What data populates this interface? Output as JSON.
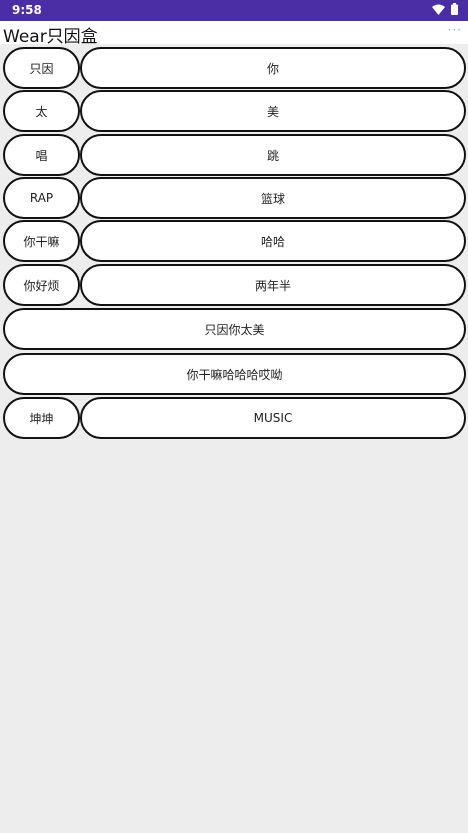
{
  "status": {
    "time": "9:58",
    "wifi_icon": "wifi-icon",
    "battery_icon": "battery-icon"
  },
  "appbar": {
    "title": "Wear只因盒",
    "menu": "···"
  },
  "rows": [
    {
      "left": "只因",
      "right": "你"
    },
    {
      "left": "太",
      "right": "美"
    },
    {
      "left": "唱",
      "right": "跳"
    },
    {
      "left": "RAP",
      "right": "篮球"
    },
    {
      "left": "你干嘛",
      "right": "哈哈"
    },
    {
      "left": "你好烦",
      "right": "两年半"
    },
    {
      "full": "只因你太美"
    },
    {
      "full": "你干嘛哈哈哈哎呦"
    },
    {
      "left": "坤坤",
      "right": "MUSIC"
    }
  ],
  "colors": {
    "statusbar": "#4a2ea6",
    "background": "#ededed",
    "button_border": "#111111"
  }
}
